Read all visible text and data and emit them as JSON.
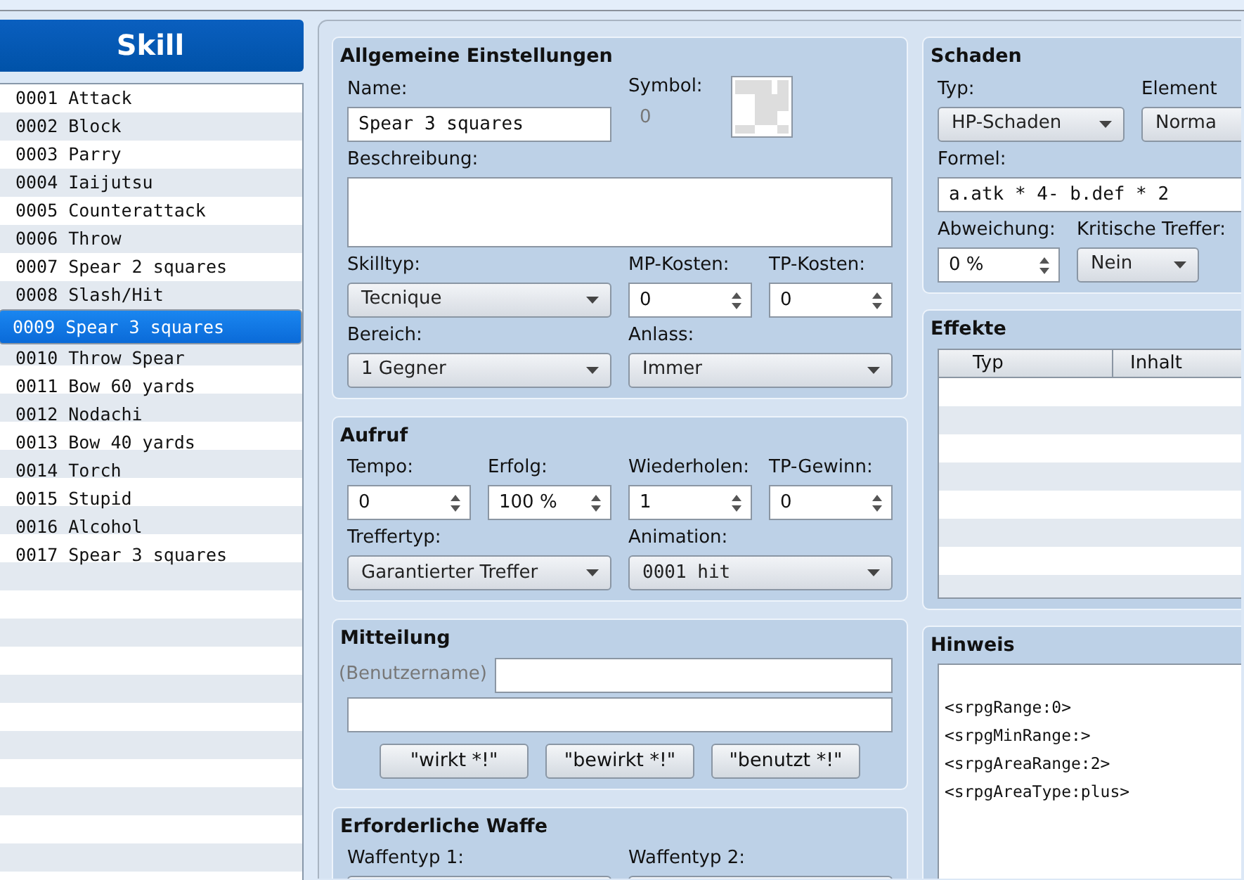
{
  "sidebar": {
    "title": "Skill",
    "items": [
      {
        "label": "0001 Attack",
        "selected": false
      },
      {
        "label": "0002 Block",
        "selected": false
      },
      {
        "label": "0003 Parry",
        "selected": false
      },
      {
        "label": "0004 Iaijutsu",
        "selected": false
      },
      {
        "label": "0005 Counterattack",
        "selected": false
      },
      {
        "label": "0006 Throw",
        "selected": false
      },
      {
        "label": "0007 Spear 2 squares",
        "selected": false
      },
      {
        "label": "0008 Slash/Hit",
        "selected": false
      },
      {
        "label": "0009 Spear 3 squares",
        "selected": true
      },
      {
        "label": "0010 Throw Spear",
        "selected": false
      },
      {
        "label": "0011 Bow 60 yards",
        "selected": false
      },
      {
        "label": "0012 Nodachi",
        "selected": false
      },
      {
        "label": "0013 Bow 40 yards",
        "selected": false
      },
      {
        "label": "0014 Torch",
        "selected": false
      },
      {
        "label": "0015 Stupid",
        "selected": false
      },
      {
        "label": "0016 Alcohol",
        "selected": false
      },
      {
        "label": "0017 Spear 3 squares",
        "selected": false
      }
    ]
  },
  "left_groups": [
    {
      "title": "Allgemeine Einstellungen",
      "field_lines": [
        [
          {
            "kind": "text",
            "label": "Name:",
            "value": "Spear 3 squares",
            "mono": true
          },
          {
            "kind": "icon",
            "label": "Symbol:",
            "value": "0"
          }
        ],
        [
          {
            "kind": "textarea",
            "label": "Beschreibung:"
          }
        ],
        [
          {
            "kind": "select",
            "label": "Skilltyp:",
            "value": "Tecnique"
          },
          {
            "kind": "spin",
            "label": "MP-Kosten:",
            "value": "0"
          },
          {
            "kind": "spin",
            "label": "TP-Kosten:",
            "value": "0"
          }
        ],
        [
          {
            "kind": "select",
            "label": "Bereich:",
            "value": "1 Gegner"
          },
          {
            "kind": "select",
            "label": "Anlass:",
            "value": "Immer"
          }
        ]
      ]
    },
    {
      "title": "Aufruf",
      "field_lines": [
        [
          {
            "kind": "spin",
            "label": "Tempo:",
            "value": "0"
          },
          {
            "kind": "spin",
            "label": "Erfolg:",
            "value": "100 %"
          },
          {
            "kind": "spin",
            "label": "Wiederholen:",
            "value": "1"
          },
          {
            "kind": "spin",
            "label": "TP-Gewinn:",
            "value": "0"
          }
        ],
        [
          {
            "kind": "select",
            "label": "Treffertyp:",
            "value": "Garantierter Treffer"
          },
          {
            "kind": "select",
            "label": "Animation:",
            "value": "0001 hit",
            "mono": true
          }
        ]
      ]
    },
    {
      "title": "Mitteilung",
      "field_lines": [
        [
          {
            "kind": "inline",
            "label": "(Benutzername)"
          }
        ],
        [
          {
            "kind": "text"
          }
        ]
      ],
      "buttons": [
        "\"wirkt *!\"",
        "\"bewirkt *!\"",
        "\"benutzt *!\""
      ]
    },
    {
      "title": "Erforderliche Waffe",
      "field_lines": [
        [
          {
            "kind": "select",
            "label": "Waffentyp 1:"
          },
          {
            "kind": "select",
            "label": "Waffentyp 2:"
          }
        ]
      ]
    }
  ],
  "right_groups": [
    {
      "kind": "form",
      "title": "Schaden",
      "field_lines": [
        [
          {
            "kind": "select",
            "label": "Typ:",
            "value": "HP-Schaden"
          },
          {
            "kind": "select",
            "label": "Element",
            "value": "Norma"
          }
        ],
        [
          {
            "kind": "text",
            "label": "Formel:",
            "value": "a.atk * 4- b.def * 2",
            "mono": true
          }
        ],
        [
          {
            "kind": "spin",
            "label": "Abweichung:",
            "value": "0 %"
          },
          {
            "kind": "select",
            "label": "Kritische Treffer:",
            "value": "Nein"
          }
        ]
      ]
    },
    {
      "kind": "table",
      "title": "Effekte",
      "columns": [
        "Typ",
        "Inhalt"
      ]
    },
    {
      "kind": "note",
      "title": "Hinweis",
      "lines": [
        "<srpgRange:0>",
        "<srpgMinRange:>",
        "<srpgAreaRange:2>",
        "<srpgAreaType:plus>"
      ]
    }
  ]
}
